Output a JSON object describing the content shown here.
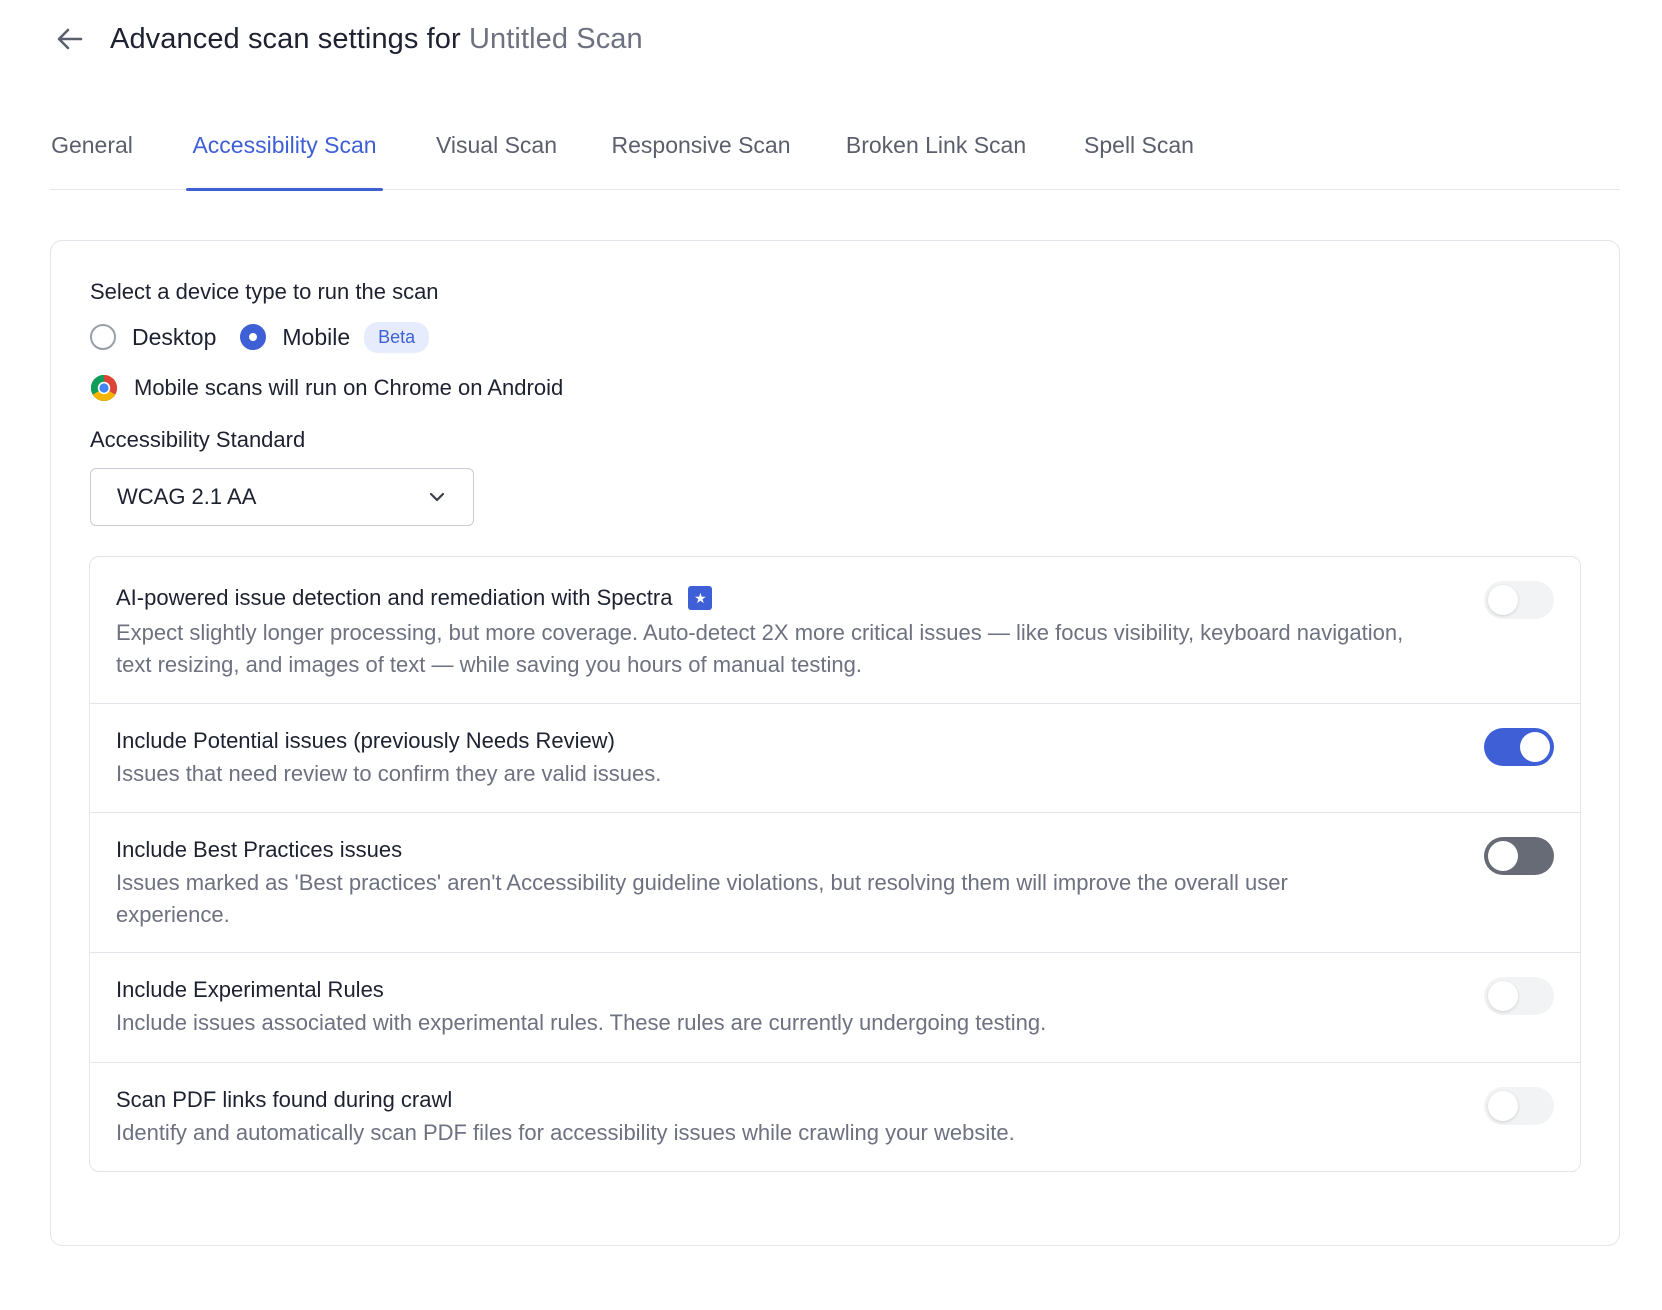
{
  "header": {
    "title_prefix": "Advanced scan settings for",
    "scan_name": "Untitled Scan"
  },
  "tabs": [
    {
      "label": "General",
      "active": false
    },
    {
      "label": "Accessibility Scan",
      "active": true
    },
    {
      "label": "Visual Scan",
      "active": false
    },
    {
      "label": "Responsive Scan",
      "active": false
    },
    {
      "label": "Broken Link Scan",
      "active": false
    },
    {
      "label": "Spell Scan",
      "active": false
    }
  ],
  "device": {
    "label": "Select a device type to run the scan",
    "options": [
      {
        "label": "Desktop",
        "selected": false
      },
      {
        "label": "Mobile",
        "selected": true
      }
    ],
    "beta_badge": "Beta",
    "info_text": "Mobile scans will run on Chrome on Android"
  },
  "standard": {
    "label": "Accessibility Standard",
    "selected": "WCAG 2.1 AA"
  },
  "settings": [
    {
      "title": "AI-powered issue detection and remediation with Spectra",
      "description": "Expect slightly longer processing, but more coverage. Auto-detect 2X more critical issues — like focus visibility, keyboard navigation, text resizing, and images of text — while saving you hours of manual testing.",
      "enabled": false
    },
    {
      "title": "Include Potential issues (previously Needs Review)",
      "description": "Issues that need review to confirm they are valid issues.",
      "enabled": true
    },
    {
      "title": "Include Best Practices issues",
      "description": "Issues marked as 'Best practices' aren't Accessibility guideline violations, but resolving them will improve the overall user experience.",
      "enabled": false
    },
    {
      "title": "Include Experimental Rules",
      "description": "Include issues associated with experimental rules. These rules are currently undergoing testing.",
      "enabled": false
    },
    {
      "title": "Scan PDF links found during crawl",
      "description": "Identify and automatically scan PDF files for accessibility issues while crawling your website.",
      "enabled": false
    }
  ],
  "colors": {
    "accent": "#3e5fd6",
    "text": "#1d2130",
    "muted": "#6d7180",
    "border": "#e3e5ea"
  }
}
